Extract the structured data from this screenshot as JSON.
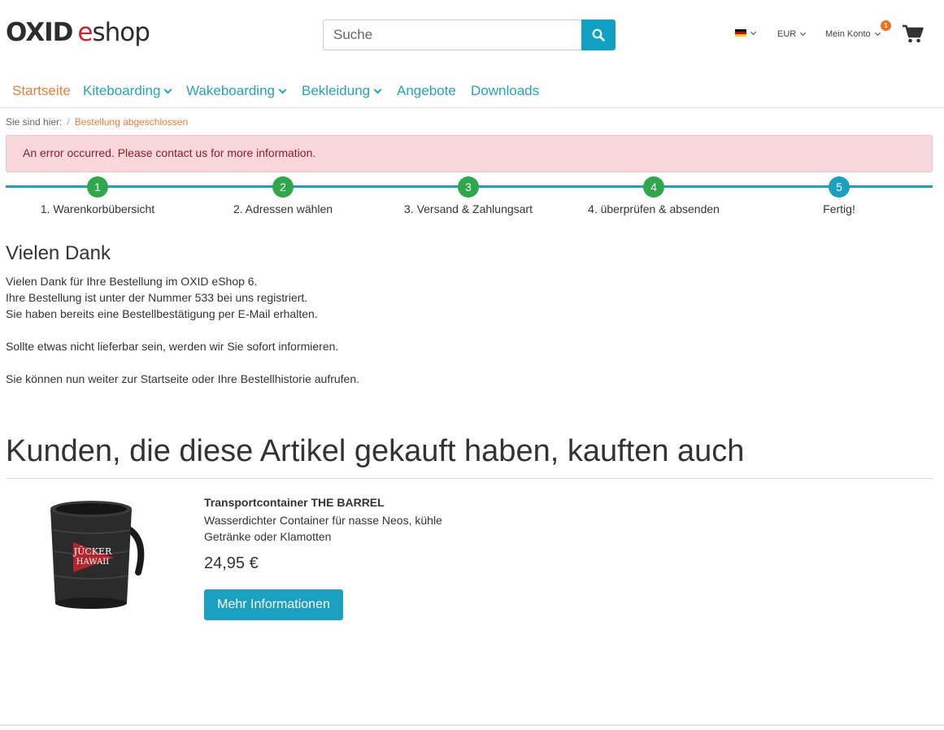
{
  "header": {
    "logo_oxid": "OXID",
    "logo_e": "e",
    "logo_shop": "shop",
    "search_placeholder": "Suche",
    "currency": "EUR",
    "account": "Mein Konto",
    "cart_count": "1"
  },
  "nav": {
    "items": [
      {
        "label": "Startseite"
      },
      {
        "label": "Kiteboarding"
      },
      {
        "label": "Wakeboarding"
      },
      {
        "label": "Bekleidung"
      },
      {
        "label": "Angebote"
      },
      {
        "label": "Downloads"
      }
    ]
  },
  "breadcrumb": {
    "prefix": "Sie sind hier:",
    "separator": "/",
    "current": "Bestellung abgeschlossen"
  },
  "alert": {
    "message": "An error occurred. Please contact us for more information."
  },
  "steps": [
    {
      "num": "1",
      "label": "1. Warenkorbübersicht"
    },
    {
      "num": "2",
      "label": "2. Adressen wählen"
    },
    {
      "num": "3",
      "label": "3. Versand & Zahlungsart"
    },
    {
      "num": "4",
      "label": "4. überprüfen & absenden"
    },
    {
      "num": "5",
      "label": "Fertig!"
    }
  ],
  "thanks": {
    "title": "Vielen Dank",
    "line1": "Vielen Dank für Ihre Bestellung im OXID eShop 6.",
    "line2": "Ihre Bestellung ist unter der Nummer 533 bei uns registriert.",
    "line3": "Sie haben bereits eine Bestellbestätigung per E-Mail erhalten.",
    "line4": "Sollte etwas nicht lieferbar sein, werden wir Sie sofort informieren.",
    "line5": "Sie können nun weiter zur Startseite oder Ihre Bestellhistorie aufrufen."
  },
  "crosssell": {
    "title": "Kunden, die diese Artikel gekauft haben, kauften auch",
    "product": {
      "name": "Transportcontainer THE BARREL",
      "description": "Wasserdichter Container für nasse Neos, kühle Getränke oder Klamotten",
      "price": "24,95 €",
      "button": "Mehr Informationen",
      "image_text_1": "JÜCKER",
      "image_text_2": "HAWAII"
    }
  },
  "colors": {
    "accent": "#1ba0c2",
    "active_nav": "#f07b3a",
    "step_done": "#2ea84a",
    "error_bg": "#f8d7da",
    "logo_red": "#d1232a"
  }
}
